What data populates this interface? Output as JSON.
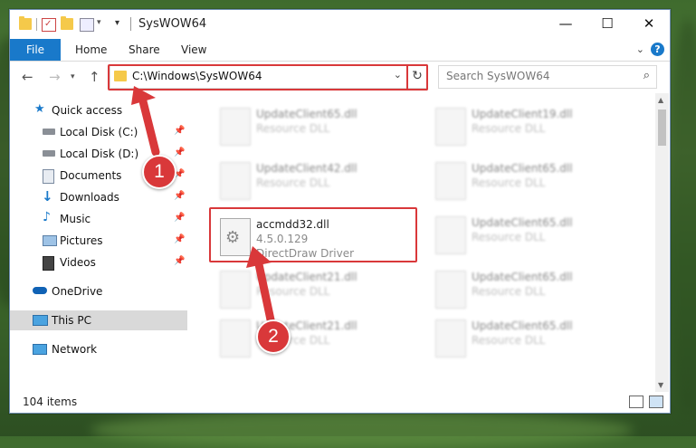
{
  "window": {
    "title": "SysWOW64",
    "controls": {
      "minimize": "—",
      "maximize": "☐",
      "close": "✕"
    }
  },
  "ribbon": {
    "tabs": [
      "File",
      "Home",
      "Share",
      "View"
    ],
    "help": "?"
  },
  "address_bar": {
    "path": "C:\\Windows\\SysWOW64",
    "search_placeholder": "Search SysWOW64"
  },
  "sidebar": {
    "items": [
      {
        "label": "Quick access",
        "icon": "star-icon"
      },
      {
        "label": "Local Disk (C:)",
        "icon": "drive-icon",
        "pinned": true
      },
      {
        "label": "Local Disk (D:)",
        "icon": "drive-icon",
        "pinned": true
      },
      {
        "label": "Documents",
        "icon": "documents-icon",
        "pinned": true
      },
      {
        "label": "Downloads",
        "icon": "download-icon",
        "pinned": true
      },
      {
        "label": "Music",
        "icon": "music-icon",
        "pinned": true
      },
      {
        "label": "Pictures",
        "icon": "pictures-icon",
        "pinned": true
      },
      {
        "label": "Videos",
        "icon": "videos-icon",
        "pinned": true
      },
      {
        "label": "OneDrive",
        "icon": "cloud-icon"
      },
      {
        "label": "This PC",
        "icon": "computer-icon",
        "selected": true
      },
      {
        "label": "Network",
        "icon": "network-icon"
      }
    ]
  },
  "files": {
    "highlighted": {
      "name": "accmdd32.dll",
      "version": "4.5.0.129",
      "description": "DirectDraw Driver"
    },
    "blurred": [
      {
        "name": "UpdateClient65.dll",
        "type": "Resource DLL"
      },
      {
        "name": "UpdateClient42.dll",
        "type": "Resource DLL"
      },
      {
        "name": "UpdateClient21.dll",
        "type": "Resource DLL"
      },
      {
        "name": "UpdateClient21.dll",
        "type": "Resource DLL"
      },
      {
        "name": "UpdateClient19.dll",
        "type": "Resource DLL"
      },
      {
        "name": "UpdateClient65.dll",
        "type": "Resource DLL"
      },
      {
        "name": "UpdateClient65.dll",
        "type": "Resource DLL"
      },
      {
        "name": "UpdateClient65.dll",
        "type": "Resource DLL"
      },
      {
        "name": "UpdateClient65.dll",
        "type": "Resource DLL"
      }
    ]
  },
  "status": {
    "item_count": "104 items"
  },
  "annotations": {
    "step1": "1",
    "step2": "2"
  },
  "colors": {
    "accent": "#1979ca",
    "highlight": "#d9383a",
    "folder": "#f5c94a"
  }
}
